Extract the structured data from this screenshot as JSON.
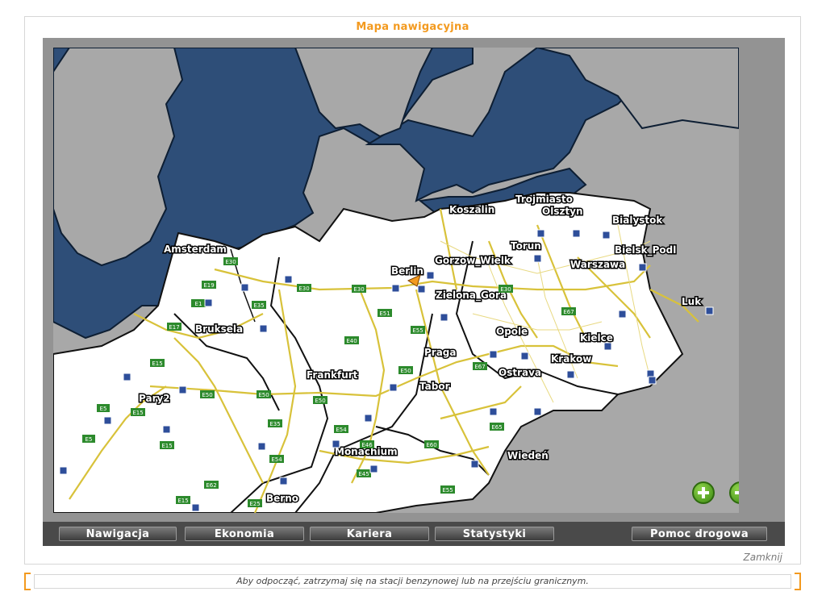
{
  "window": {
    "title": "Mapa nawigacyjna",
    "close_label": "Zamknij"
  },
  "nav": {
    "buttons": [
      {
        "label": "Nawigacja"
      },
      {
        "label": "Ekonomia"
      },
      {
        "label": "Kariera"
      },
      {
        "label": "Statystyki"
      },
      {
        "label": "Pomoc drogowa"
      }
    ]
  },
  "tip": "Aby odpocząć, zatrzymaj się na stacji benzynowej lub na przejściu granicznym.",
  "map": {
    "zoom_in_icon": "zoom-in-icon",
    "zoom_out_icon": "zoom-out-icon",
    "player_icon": "player-truck-arrow-icon",
    "cities": [
      "Amsterdam",
      "Bruksela",
      "Pary2",
      "Frankfurt",
      "Berlin",
      "Koszalin",
      "Trojmiasto",
      "Olsztyn",
      "Bialystok",
      "Torun",
      "Gorzow_Wielk",
      "Bielsk_Podl",
      "Warszawa",
      "Zielona_Gora",
      "Luk",
      "Opole",
      "Kielce",
      "Praga",
      "Krakow",
      "Ostrava",
      "Tabor",
      "Monachium",
      "Wiedeń",
      "Berno"
    ],
    "roads": [
      "E30",
      "E19",
      "E1",
      "E17",
      "E15",
      "E5",
      "E35",
      "E40",
      "E51",
      "E55",
      "E50",
      "E54",
      "E46",
      "E45",
      "E62",
      "E25",
      "E60",
      "E65",
      "E67",
      "E55",
      "E30",
      "E30",
      "E30",
      "E67",
      "E15",
      "E5",
      "E15",
      "E50",
      "E50",
      "E50",
      "E35",
      "E54",
      "E15"
    ]
  }
}
